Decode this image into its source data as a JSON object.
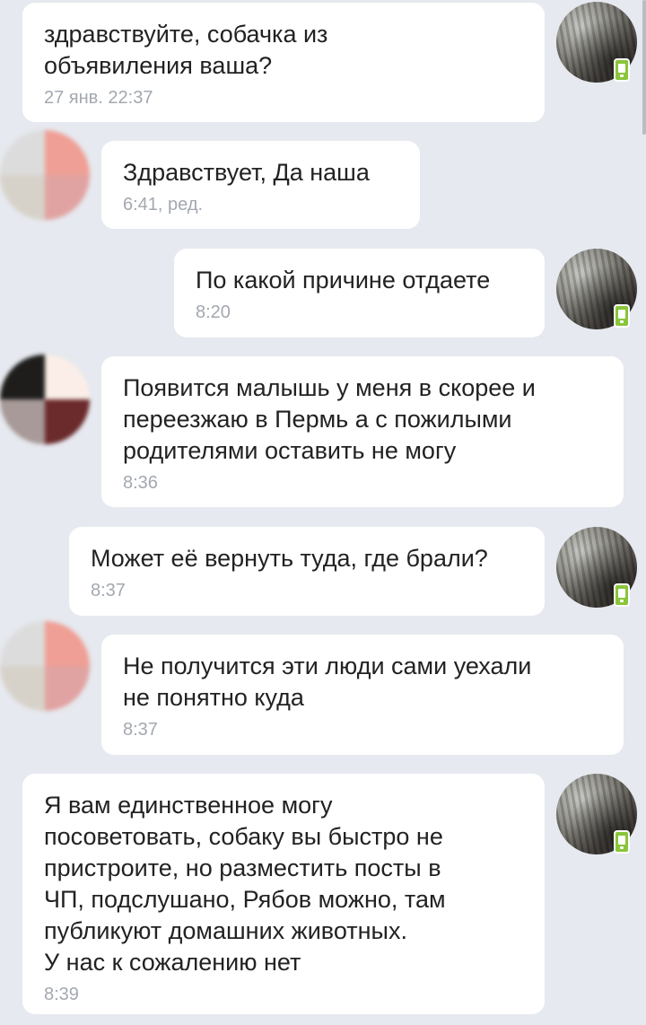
{
  "messages": [
    {
      "text": "здравствуйте, собачка из\nобъявиления ваша?",
      "time": "27 янв. 22:37"
    },
    {
      "text": "Здравствует, Да наша",
      "time": "6:41, ред."
    },
    {
      "text": "По какой причине отдаете",
      "time": "8:20"
    },
    {
      "text": "Появится малышь у меня в скорее и\nпереезжаю в Пермь а с пожилыми\nродителями оставить не могу",
      "time": "8:36"
    },
    {
      "text": "Может её вернуть туда, где брали?",
      "time": "8:37"
    },
    {
      "text": "Не получится эти люди сами уехали\nне понятно куда",
      "time": "8:37"
    },
    {
      "text": "Я вам единственное могу\nпосоветовать, собаку вы быстро не\nпристроите, но разместить посты в\nЧП, подслушано, Рябов можно, там\nпубликуют домашних животных.\nУ нас к сожалению нет",
      "time": "8:39"
    }
  ],
  "avatars": {
    "me": {
      "name": "avatar-me",
      "badge": "mobile-phone-icon",
      "badge_color": "#8ac53a"
    },
    "contact_a": {
      "colors": [
        "#dcdcdc",
        "#ef9f95",
        "#d7d2c9",
        "#e1a3a1"
      ]
    },
    "contact_b": {
      "colors": [
        "#1e1d1b",
        "#fbeee8",
        "#a79a98",
        "#6b2a2b"
      ]
    }
  },
  "colors": {
    "background": "#e6e9ef",
    "bubble": "#ffffff",
    "text": "#222222",
    "time": "#a3a8b0"
  }
}
